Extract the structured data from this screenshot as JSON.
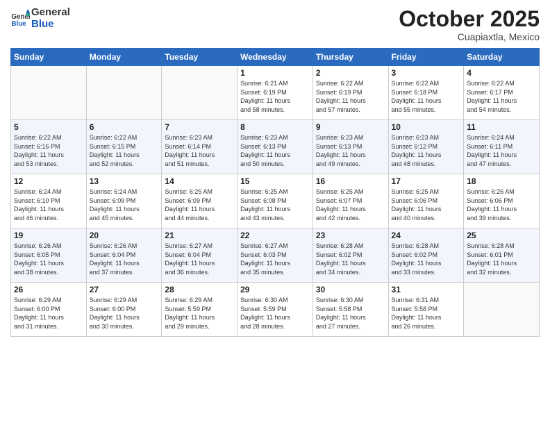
{
  "header": {
    "logo_line1": "General",
    "logo_line2": "Blue",
    "month_title": "October 2025",
    "location": "Cuapiaxtla, Mexico"
  },
  "weekdays": [
    "Sunday",
    "Monday",
    "Tuesday",
    "Wednesday",
    "Thursday",
    "Friday",
    "Saturday"
  ],
  "weeks": [
    [
      {
        "day": "",
        "info": ""
      },
      {
        "day": "",
        "info": ""
      },
      {
        "day": "",
        "info": ""
      },
      {
        "day": "1",
        "info": "Sunrise: 6:21 AM\nSunset: 6:19 PM\nDaylight: 11 hours\nand 58 minutes."
      },
      {
        "day": "2",
        "info": "Sunrise: 6:22 AM\nSunset: 6:19 PM\nDaylight: 11 hours\nand 57 minutes."
      },
      {
        "day": "3",
        "info": "Sunrise: 6:22 AM\nSunset: 6:18 PM\nDaylight: 11 hours\nand 55 minutes."
      },
      {
        "day": "4",
        "info": "Sunrise: 6:22 AM\nSunset: 6:17 PM\nDaylight: 11 hours\nand 54 minutes."
      }
    ],
    [
      {
        "day": "5",
        "info": "Sunrise: 6:22 AM\nSunset: 6:16 PM\nDaylight: 11 hours\nand 53 minutes."
      },
      {
        "day": "6",
        "info": "Sunrise: 6:22 AM\nSunset: 6:15 PM\nDaylight: 11 hours\nand 52 minutes."
      },
      {
        "day": "7",
        "info": "Sunrise: 6:23 AM\nSunset: 6:14 PM\nDaylight: 11 hours\nand 51 minutes."
      },
      {
        "day": "8",
        "info": "Sunrise: 6:23 AM\nSunset: 6:13 PM\nDaylight: 11 hours\nand 50 minutes."
      },
      {
        "day": "9",
        "info": "Sunrise: 6:23 AM\nSunset: 6:13 PM\nDaylight: 11 hours\nand 49 minutes."
      },
      {
        "day": "10",
        "info": "Sunrise: 6:23 AM\nSunset: 6:12 PM\nDaylight: 11 hours\nand 48 minutes."
      },
      {
        "day": "11",
        "info": "Sunrise: 6:24 AM\nSunset: 6:11 PM\nDaylight: 11 hours\nand 47 minutes."
      }
    ],
    [
      {
        "day": "12",
        "info": "Sunrise: 6:24 AM\nSunset: 6:10 PM\nDaylight: 11 hours\nand 46 minutes."
      },
      {
        "day": "13",
        "info": "Sunrise: 6:24 AM\nSunset: 6:09 PM\nDaylight: 11 hours\nand 45 minutes."
      },
      {
        "day": "14",
        "info": "Sunrise: 6:25 AM\nSunset: 6:09 PM\nDaylight: 11 hours\nand 44 minutes."
      },
      {
        "day": "15",
        "info": "Sunrise: 6:25 AM\nSunset: 6:08 PM\nDaylight: 11 hours\nand 43 minutes."
      },
      {
        "day": "16",
        "info": "Sunrise: 6:25 AM\nSunset: 6:07 PM\nDaylight: 11 hours\nand 42 minutes."
      },
      {
        "day": "17",
        "info": "Sunrise: 6:25 AM\nSunset: 6:06 PM\nDaylight: 11 hours\nand 40 minutes."
      },
      {
        "day": "18",
        "info": "Sunrise: 6:26 AM\nSunset: 6:06 PM\nDaylight: 11 hours\nand 39 minutes."
      }
    ],
    [
      {
        "day": "19",
        "info": "Sunrise: 6:26 AM\nSunset: 6:05 PM\nDaylight: 11 hours\nand 38 minutes."
      },
      {
        "day": "20",
        "info": "Sunrise: 6:26 AM\nSunset: 6:04 PM\nDaylight: 11 hours\nand 37 minutes."
      },
      {
        "day": "21",
        "info": "Sunrise: 6:27 AM\nSunset: 6:04 PM\nDaylight: 11 hours\nand 36 minutes."
      },
      {
        "day": "22",
        "info": "Sunrise: 6:27 AM\nSunset: 6:03 PM\nDaylight: 11 hours\nand 35 minutes."
      },
      {
        "day": "23",
        "info": "Sunrise: 6:28 AM\nSunset: 6:02 PM\nDaylight: 11 hours\nand 34 minutes."
      },
      {
        "day": "24",
        "info": "Sunrise: 6:28 AM\nSunset: 6:02 PM\nDaylight: 11 hours\nand 33 minutes."
      },
      {
        "day": "25",
        "info": "Sunrise: 6:28 AM\nSunset: 6:01 PM\nDaylight: 11 hours\nand 32 minutes."
      }
    ],
    [
      {
        "day": "26",
        "info": "Sunrise: 6:29 AM\nSunset: 6:00 PM\nDaylight: 11 hours\nand 31 minutes."
      },
      {
        "day": "27",
        "info": "Sunrise: 6:29 AM\nSunset: 6:00 PM\nDaylight: 11 hours\nand 30 minutes."
      },
      {
        "day": "28",
        "info": "Sunrise: 6:29 AM\nSunset: 5:59 PM\nDaylight: 11 hours\nand 29 minutes."
      },
      {
        "day": "29",
        "info": "Sunrise: 6:30 AM\nSunset: 5:59 PM\nDaylight: 11 hours\nand 28 minutes."
      },
      {
        "day": "30",
        "info": "Sunrise: 6:30 AM\nSunset: 5:58 PM\nDaylight: 11 hours\nand 27 minutes."
      },
      {
        "day": "31",
        "info": "Sunrise: 6:31 AM\nSunset: 5:58 PM\nDaylight: 11 hours\nand 26 minutes."
      },
      {
        "day": "",
        "info": ""
      }
    ]
  ]
}
